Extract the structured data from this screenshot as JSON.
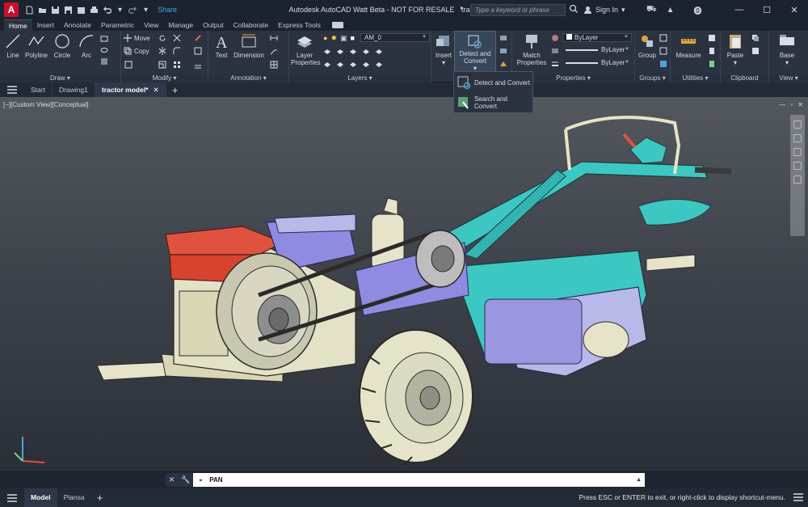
{
  "app": {
    "badge": "A",
    "title_parts": [
      "Autodesk AutoCAD Watt Beta - NOT FOR RESALE",
      "tractor model.dwg"
    ],
    "share_label": "Share"
  },
  "search": {
    "placeholder": "Type a keyword or phrase"
  },
  "user": {
    "signin_label": "Sign In"
  },
  "ribbon_tabs": [
    "Home",
    "Insert",
    "Annotate",
    "Parametric",
    "View",
    "Manage",
    "Output",
    "Collaborate",
    "Express Tools"
  ],
  "panels": {
    "draw": {
      "label": "Draw",
      "tools": [
        "Line",
        "Polyline",
        "Circle",
        "Arc"
      ]
    },
    "modify": {
      "label": "Modify",
      "move": "Move",
      "copy": "Copy"
    },
    "annotation": {
      "label": "Annotation",
      "text": "Text",
      "dimension": "Dimension"
    },
    "layers": {
      "label": "Layers",
      "tool": "Layer Properties",
      "current_layer": "AM_0"
    },
    "block": {
      "insert": "Insert",
      "detect": "Detect and Convert"
    },
    "properties": {
      "label": "Properties",
      "match": "Match Properties",
      "color": "ByLayer",
      "linetype": "ByLayer",
      "lineweight": "ByLayer"
    },
    "groups": {
      "label": "Groups",
      "group": "Group"
    },
    "utilities": {
      "label": "Utilities",
      "measure": "Measure"
    },
    "clipboard": {
      "label": "Clipboard",
      "paste": "Paste"
    },
    "view": {
      "label": "View",
      "base": "Base"
    }
  },
  "flyout": {
    "items": [
      "Detect and Convert",
      "Search and Convert"
    ]
  },
  "doc_tabs": [
    "Start",
    "Drawing1",
    "tractor model*"
  ],
  "viewport": {
    "label": "[−][Custom View][Conceptual]"
  },
  "command": {
    "value": "PAN"
  },
  "layout_tabs": [
    "Model",
    "Plansa"
  ],
  "status": {
    "message": "Press ESC or ENTER to exit, or right-click to display shortcut-menu."
  },
  "colors": {
    "accent": "#4aa3df",
    "brand": "#c8102e",
    "teal": "#3cc7c2",
    "red_part": "#e0523f",
    "purple_part": "#8f8be0"
  }
}
